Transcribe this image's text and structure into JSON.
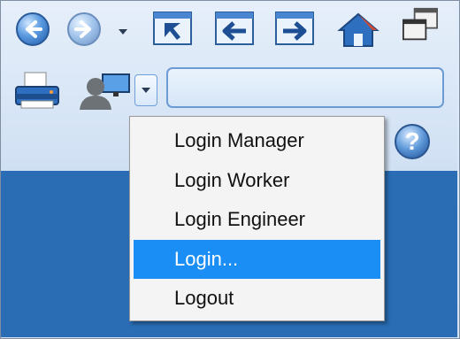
{
  "toolbar": {
    "nav_back": "back-button",
    "nav_forward": "forward-button",
    "icons": [
      "cursor-window-icon",
      "back-window-icon",
      "forward-window-icon",
      "home-icon",
      "restore-windows-icon"
    ],
    "search_value": ""
  },
  "user_menu": {
    "items": [
      {
        "label": "Login Manager",
        "selected": false
      },
      {
        "label": "Login Worker",
        "selected": false
      },
      {
        "label": "Login Engineer",
        "selected": false
      },
      {
        "label": "Login...",
        "selected": true
      },
      {
        "label": "Logout",
        "selected": false
      }
    ]
  },
  "colors": {
    "selection": "#1a8ef5",
    "background_blue": "#2a6db5"
  }
}
